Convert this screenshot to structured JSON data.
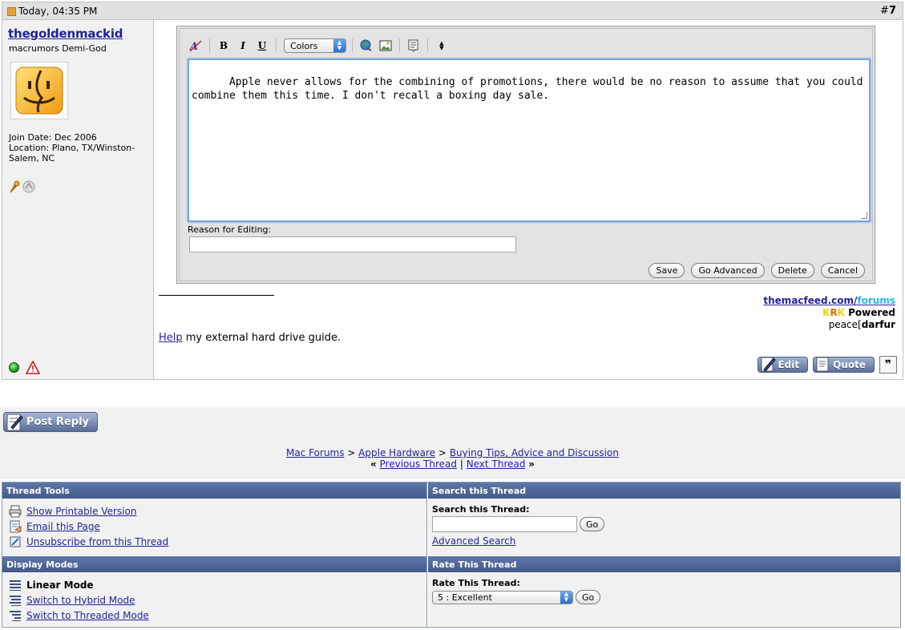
{
  "post": {
    "date": "Today, 04:35 PM",
    "number_prefix": "#",
    "number": "7",
    "username": "thegoldenmackid",
    "user_title": "macrumors Demi-God",
    "join_date": "Join Date: Dec 2006",
    "location": "Location: Plano, TX/Winston-Salem, NC"
  },
  "editor": {
    "bold": "B",
    "italic": "I",
    "underline": "U",
    "colors_label": "Colors",
    "message": "Apple never allows for the combining of promotions, there would be no reason to assume that you could combine them this time. I don't recall a boxing day sale.",
    "reason_label": "Reason for Editing:",
    "reason_value": "",
    "buttons": {
      "save": "Save",
      "go_advanced": "Go Advanced",
      "delete": "Delete",
      "cancel": "Cancel"
    }
  },
  "signature": {
    "site_main": "themacfeed.com/",
    "site_forums": "forums",
    "krk_k1": "K",
    "krk_r": "R",
    "krk_k2": "K",
    "krk_powered": " Powered",
    "peace_prefix": "peace[",
    "peace_word": "darfur",
    "help_link": "Help",
    "help_rest": " my external hard drive guide."
  },
  "post_actions": {
    "edit": "Edit",
    "quote": "Quote"
  },
  "reply": {
    "post_reply": "Post Reply"
  },
  "breadcrumb": {
    "items": [
      "Mac Forums",
      "Apple Hardware",
      "Buying Tips, Advice and Discussion"
    ],
    "separator": ">",
    "prev_thread": "Previous Thread",
    "next_thread": "Next Thread",
    "laquo": "«",
    "raquo": "»",
    "pipe": "|"
  },
  "thread_tools": {
    "header": "Thread Tools",
    "items": [
      "Show Printable Version",
      "Email this Page",
      "Unsubscribe from this Thread"
    ]
  },
  "search_thread": {
    "header": "Search this Thread",
    "label": "Search this Thread:",
    "value": "",
    "go": "Go",
    "advanced": "Advanced Search"
  },
  "display_modes": {
    "header": "Display Modes",
    "current": "Linear Mode",
    "items": [
      "Switch to Hybrid Mode",
      "Switch to Threaded Mode"
    ]
  },
  "rate_thread": {
    "header": "Rate This Thread",
    "label": "Rate This Thread:",
    "selected": "5 : Excellent",
    "go": "Go"
  }
}
